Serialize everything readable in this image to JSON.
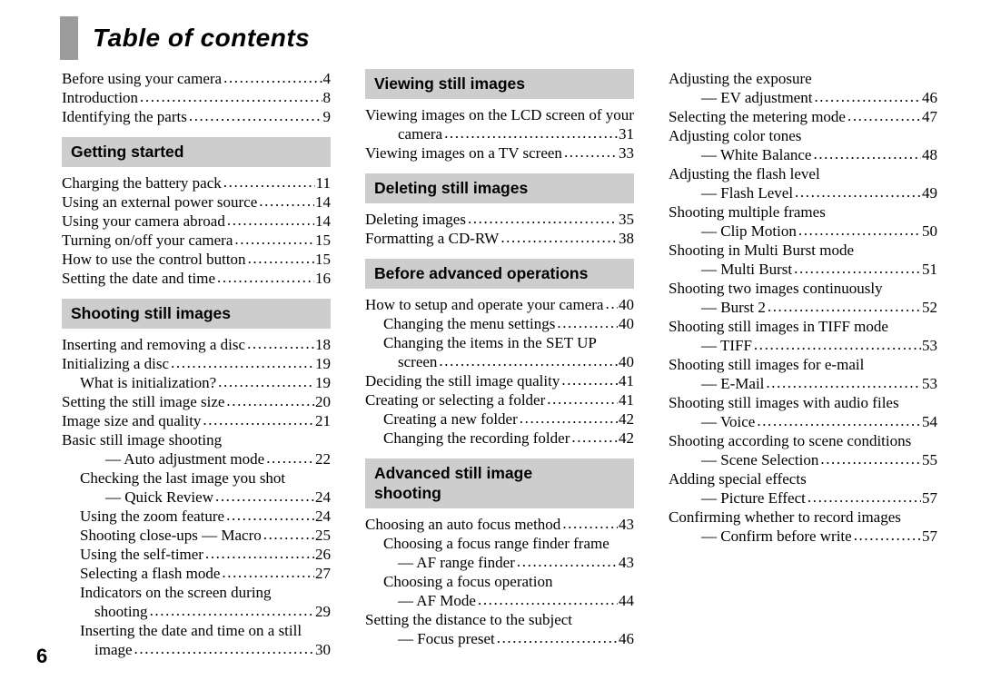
{
  "document": {
    "title": "Table of contents",
    "folio": "6"
  },
  "colors": {
    "title_block_gray": "#9b9b9b",
    "section_bar_gray": "#cdcdcd",
    "text": "#000000",
    "page_background": "#ffffff"
  },
  "columns": [
    {
      "id": "column-1",
      "blocks": [
        {
          "type": "entries",
          "entries": [
            {
              "label": "Before using your camera",
              "page": "4",
              "indent": 0
            },
            {
              "label": "Introduction",
              "page": "8",
              "indent": 0
            },
            {
              "label": "Identifying the parts ",
              "page": "9",
              "indent": 0
            }
          ]
        },
        {
          "type": "section",
          "heading": "Getting started",
          "entries": [
            {
              "label": "Charging the battery pack",
              "page": "11",
              "indent": 0
            },
            {
              "label": "Using an external power source",
              "page": "14",
              "indent": 0
            },
            {
              "label": "Using your camera abroad",
              "page": "14",
              "indent": 0
            },
            {
              "label": "Turning on/off your camera",
              "page": "15",
              "indent": 0
            },
            {
              "label": "How to use the control button",
              "page": "15",
              "indent": 0
            },
            {
              "label": "Setting the date and time",
              "page": "16",
              "indent": 0
            }
          ]
        },
        {
          "type": "section",
          "heading": "Shooting still images",
          "entries": [
            {
              "label": "Inserting and removing a disc",
              "page": "18",
              "indent": 0
            },
            {
              "label": "Initializing a disc",
              "page": "19",
              "indent": 0
            },
            {
              "label": "What is initialization?",
              "page": "19",
              "indent": 1
            },
            {
              "label": "Setting the still image size",
              "page": "20",
              "indent": 0
            },
            {
              "label": "Image size and quality",
              "page": "21",
              "indent": 0
            },
            {
              "label": "Basic still image shooting",
              "page": "",
              "indent": 0
            },
            {
              "label": "— Auto adjustment mode",
              "page": "22",
              "indent": 3
            },
            {
              "label": "Checking the last image you shot",
              "page": "",
              "indent": 1
            },
            {
              "label": "— Quick Review",
              "page": "24",
              "indent": 3
            },
            {
              "label": "Using the zoom feature",
              "page": "24",
              "indent": 1
            },
            {
              "label": "Shooting close-ups — Macro",
              "page": "25",
              "indent": 1
            },
            {
              "label": "Using the self-timer",
              "page": "26",
              "indent": 1
            },
            {
              "label": "Selecting a flash mode",
              "page": "27",
              "indent": 1
            },
            {
              "label": "Indicators on the screen during",
              "page": "",
              "indent": 1
            },
            {
              "label": "shooting",
              "page": "29",
              "indent": 2
            },
            {
              "label": "Inserting the date and time on a still",
              "page": "",
              "indent": 1
            },
            {
              "label": "image",
              "page": "30",
              "indent": 2
            }
          ]
        }
      ]
    },
    {
      "id": "column-2",
      "blocks": [
        {
          "type": "section",
          "heading": "Viewing still images",
          "entries": [
            {
              "label": "Viewing images on the LCD screen of your",
              "page": "",
              "indent": 0
            },
            {
              "label": "camera",
              "page": "31",
              "indent": 2
            },
            {
              "label": "Viewing images on a TV screen",
              "page": "33",
              "indent": 0
            }
          ]
        },
        {
          "type": "section",
          "heading": "Deleting still images",
          "entries": [
            {
              "label": "Deleting images",
              "page": "35",
              "indent": 0
            },
            {
              "label": "Formatting a CD-RW",
              "page": "38",
              "indent": 0
            }
          ]
        },
        {
          "type": "section",
          "heading": "Before advanced operations",
          "entries": [
            {
              "label": "How to setup and operate your camera",
              "page": "40",
              "indent": 0
            },
            {
              "label": "Changing the menu settings",
              "page": "40",
              "indent": 1
            },
            {
              "label": "Changing the items in the SET UP",
              "page": "",
              "indent": 1
            },
            {
              "label": "screen",
              "page": "40",
              "indent": 2
            },
            {
              "label": "Deciding the still image quality",
              "page": "41",
              "indent": 0
            },
            {
              "label": "Creating or selecting a folder",
              "page": "41",
              "indent": 0
            },
            {
              "label": "Creating a new folder",
              "page": "42",
              "indent": 1
            },
            {
              "label": "Changing the recording folder",
              "page": "42",
              "indent": 1
            }
          ]
        },
        {
          "type": "section",
          "heading": "Advanced still image\nshooting",
          "entries": [
            {
              "label": "Choosing an auto focus method",
              "page": "43",
              "indent": 0
            },
            {
              "label": "Choosing a focus range finder frame",
              "page": "",
              "indent": 1
            },
            {
              "label": "— AF range finder",
              "page": "43",
              "indent": 2
            },
            {
              "label": "Choosing a focus operation",
              "page": "",
              "indent": 1
            },
            {
              "label": "— AF Mode",
              "page": "44",
              "indent": 2
            },
            {
              "label": "Setting the distance to the subject",
              "page": "",
              "indent": 0
            },
            {
              "label": "— Focus preset",
              "page": "46",
              "indent": 2
            }
          ]
        }
      ]
    },
    {
      "id": "column-3",
      "blocks": [
        {
          "type": "entries",
          "entries": [
            {
              "label": "Adjusting the exposure",
              "page": "",
              "indent": 0
            },
            {
              "label": "— EV adjustment",
              "page": "46",
              "indent": 2
            },
            {
              "label": "Selecting the metering mode",
              "page": "47",
              "indent": 0
            },
            {
              "label": "Adjusting color tones",
              "page": "",
              "indent": 0
            },
            {
              "label": "— White Balance",
              "page": "48",
              "indent": 2
            },
            {
              "label": "Adjusting the flash level",
              "page": "",
              "indent": 0
            },
            {
              "label": "— Flash Level",
              "page": "49",
              "indent": 2
            },
            {
              "label": "Shooting multiple frames",
              "page": "",
              "indent": 0
            },
            {
              "label": "— Clip Motion",
              "page": "50",
              "indent": 2
            },
            {
              "label": "Shooting in Multi Burst mode",
              "page": "",
              "indent": 0
            },
            {
              "label": "— Multi Burst",
              "page": "51",
              "indent": 2
            },
            {
              "label": "Shooting two images continuously",
              "page": "",
              "indent": 0
            },
            {
              "label": "— Burst 2",
              "page": "52",
              "indent": 2
            },
            {
              "label": "Shooting still images in TIFF mode",
              "page": "",
              "indent": 0
            },
            {
              "label": "— TIFF",
              "page": "53",
              "indent": 2
            },
            {
              "label": "Shooting still images for e-mail",
              "page": "",
              "indent": 0
            },
            {
              "label": "— E-Mail",
              "page": "53",
              "indent": 2
            },
            {
              "label": "Shooting still images with audio files",
              "page": "",
              "indent": 0
            },
            {
              "label": "— Voice",
              "page": "54",
              "indent": 2
            },
            {
              "label": "Shooting according to scene conditions",
              "page": "",
              "indent": 0
            },
            {
              "label": "— Scene Selection",
              "page": "55",
              "indent": 2
            },
            {
              "label": "Adding special effects",
              "page": "",
              "indent": 0
            },
            {
              "label": "— Picture Effect",
              "page": "57",
              "indent": 2
            },
            {
              "label": "Confirming whether to record images",
              "page": "",
              "indent": 0
            },
            {
              "label": "— Confirm before write",
              "page": "57",
              "indent": 2
            }
          ]
        }
      ]
    }
  ]
}
